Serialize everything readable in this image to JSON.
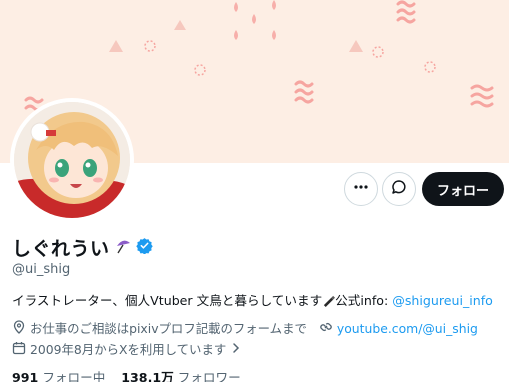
{
  "profile": {
    "display_name": "しぐれうい",
    "handle": "@ui_shig",
    "bio_text": "イラストレーター、個人Vtuber 文鳥と暮らしています",
    "bio_info_label": "公式info: ",
    "bio_link": "@shigureui_info",
    "location_text": "お仕事のご相談はpixivプロフ記載のフォームまで",
    "website": "youtube.com/@ui_shig",
    "joined": "2009年8月からXを利用しています",
    "following_count": "991",
    "following_label": "フォロー中",
    "followers_count": "138.1万",
    "followers_label": "フォロワー"
  },
  "actions": {
    "follow_label": "フォロー"
  },
  "icons": {
    "more": "more-horizontal-icon",
    "message": "message-icon",
    "verified": "verified-badge-icon",
    "location": "location-pin-icon",
    "link": "link-icon",
    "calendar": "calendar-icon",
    "chevron": "chevron-right-icon"
  },
  "colors": {
    "accent": "#1d9bf0",
    "banner": "#fdeee4",
    "banner_pattern": "#f6a5a0",
    "follow_button": "#0f1419"
  }
}
